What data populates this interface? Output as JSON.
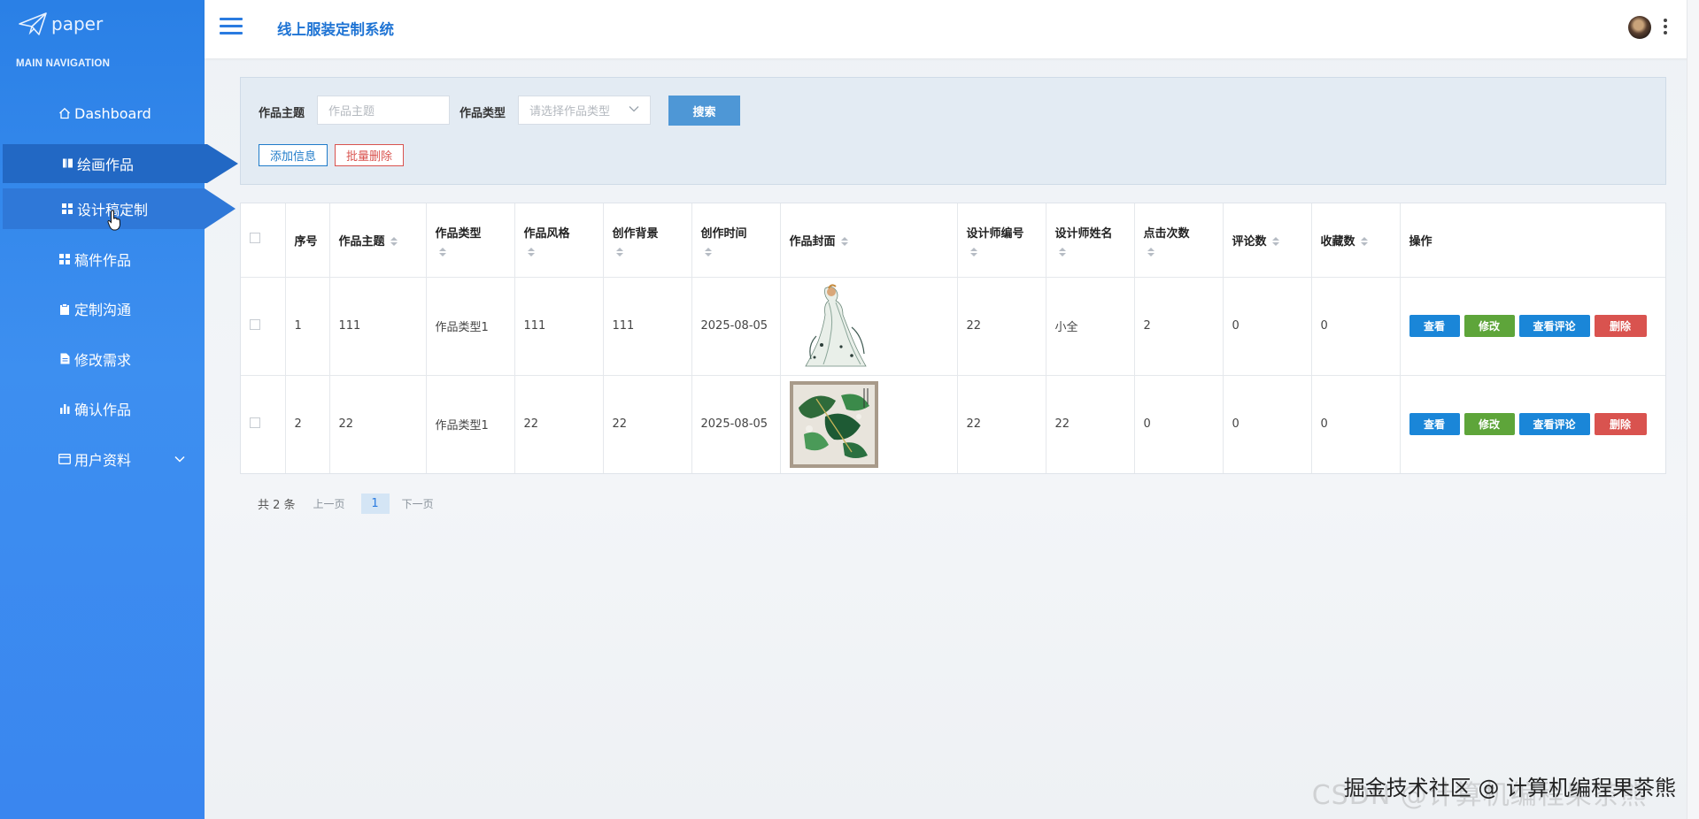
{
  "brand": {
    "name": "paper"
  },
  "sidebar": {
    "header": "MAIN NAVIGATION",
    "items": [
      {
        "label": "Dashboard",
        "icon": "home-icon"
      },
      {
        "label": "绘画作品",
        "icon": "book-icon"
      },
      {
        "label": "设计稿定制",
        "icon": "grid-icon"
      },
      {
        "label": "稿件作品",
        "icon": "grid-icon"
      },
      {
        "label": "定制沟通",
        "icon": "clipboard-icon"
      },
      {
        "label": "修改需求",
        "icon": "file-icon"
      },
      {
        "label": "确认作品",
        "icon": "bar-chart-icon"
      },
      {
        "label": "用户资料",
        "icon": "id-card-icon"
      }
    ]
  },
  "header": {
    "title": "线上服装定制系统"
  },
  "search": {
    "topic_label": "作品主题",
    "topic_placeholder": "作品主题",
    "type_label": "作品类型",
    "type_placeholder": "请选择作品类型",
    "search_button": "搜索",
    "add_button": "添加信息",
    "batch_delete_button": "批量删除"
  },
  "table": {
    "columns": [
      "序号",
      "作品主题",
      "作品类型",
      "作品风格",
      "创作背景",
      "创作时间",
      "作品封面",
      "设计师编号",
      "设计师姓名",
      "点击次数",
      "评论数",
      "收藏数",
      "操作"
    ],
    "rows": [
      {
        "index": "1",
        "topic": "111",
        "type": "作品类型1",
        "style": "111",
        "background": "111",
        "time": "2025-08-05",
        "designer_no": "22",
        "designer_name": "小全",
        "clicks": "2",
        "comments": "0",
        "favorites": "0"
      },
      {
        "index": "2",
        "topic": "22",
        "type": "作品类型1",
        "style": "22",
        "background": "22",
        "time": "2025-08-05",
        "designer_no": "22",
        "designer_name": "22",
        "clicks": "0",
        "comments": "0",
        "favorites": "0"
      }
    ],
    "actions": {
      "view": "查看",
      "edit": "修改",
      "comments": "查看评论",
      "delete": "删除"
    }
  },
  "pagination": {
    "total": "共 2 条",
    "prev": "上一页",
    "current": "1",
    "next": "下一页"
  },
  "watermark": {
    "text": "掘金技术社区 @ 计算机编程果茶熊",
    "ghost": "CSDN @计算机编程果茶熊"
  },
  "colors": {
    "sidebar": "#3a86ef",
    "active_nav": "#2268c4",
    "primary": "#1a86d8",
    "success": "#5ea53a",
    "danger": "#d9534f"
  }
}
